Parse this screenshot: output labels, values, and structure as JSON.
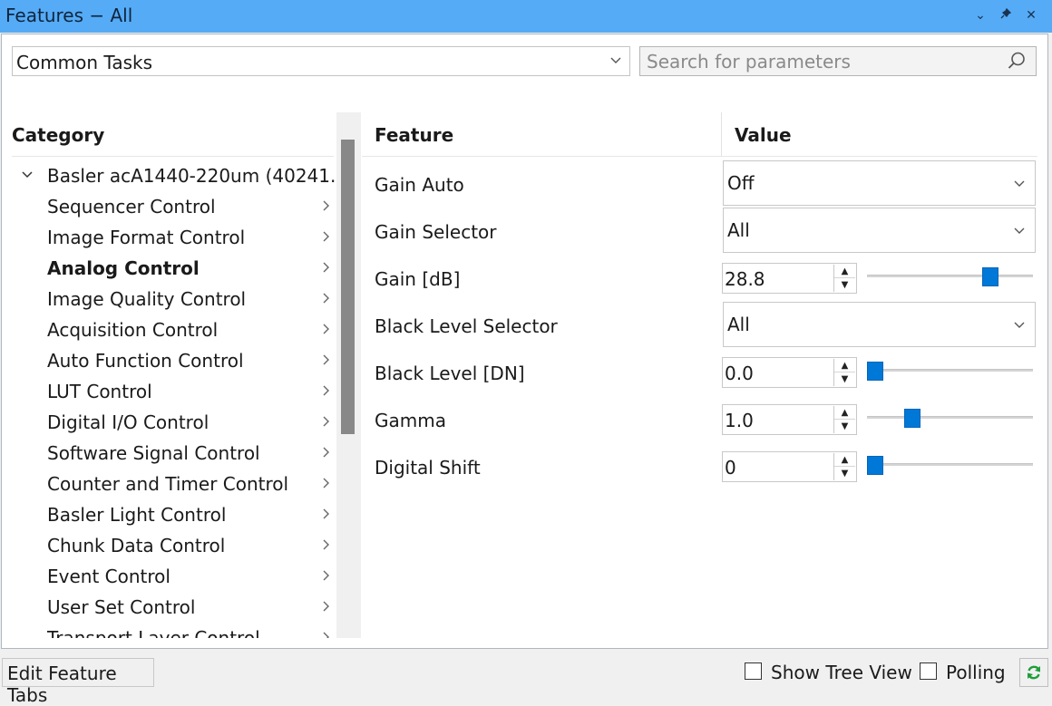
{
  "window": {
    "title": "Features − All",
    "minimize_glyph": "⌄",
    "pin_glyph": "✦",
    "close_glyph": "✕"
  },
  "toolbar": {
    "task_filter": "Common Tasks",
    "search_placeholder": "Search for parameters"
  },
  "category_pane": {
    "header": "Category",
    "root": "Basler acA1440-220um (40241...",
    "items": [
      {
        "label": "Sequencer Control",
        "selected": false
      },
      {
        "label": "Image Format Control",
        "selected": false
      },
      {
        "label": "Analog Control",
        "selected": true
      },
      {
        "label": "Image Quality Control",
        "selected": false
      },
      {
        "label": "Acquisition Control",
        "selected": false
      },
      {
        "label": "Auto Function Control",
        "selected": false
      },
      {
        "label": "LUT Control",
        "selected": false
      },
      {
        "label": "Digital I/O Control",
        "selected": false
      },
      {
        "label": "Software Signal Control",
        "selected": false
      },
      {
        "label": "Counter and Timer Control",
        "selected": false
      },
      {
        "label": "Basler Light Control",
        "selected": false
      },
      {
        "label": "Chunk Data Control",
        "selected": false
      },
      {
        "label": "Event Control",
        "selected": false
      },
      {
        "label": "User Set Control",
        "selected": false
      },
      {
        "label": "Transport Layer Control",
        "selected": false
      }
    ]
  },
  "features": {
    "feature_header": "Feature",
    "value_header": "Value",
    "rows": [
      {
        "label": "Gain Auto",
        "type": "dropdown",
        "value": "Off"
      },
      {
        "label": "Gain Selector",
        "type": "dropdown",
        "value": "All"
      },
      {
        "label": "Gain [dB]",
        "type": "spin_slider",
        "value": "28.8",
        "slider_fraction": 0.77
      },
      {
        "label": "Black Level Selector",
        "type": "dropdown",
        "value": "All"
      },
      {
        "label": "Black Level [DN]",
        "type": "spin_slider",
        "value": "0.0",
        "slider_fraction": 0.0
      },
      {
        "label": "Gamma",
        "type": "spin_slider",
        "value": "1.0",
        "slider_fraction": 0.25
      },
      {
        "label": "Digital Shift",
        "type": "spin_slider",
        "value": "0",
        "slider_fraction": 0.0
      }
    ]
  },
  "bottom_bar": {
    "edit_tabs": "Edit Feature Tabs",
    "show_tree_view": "Show Tree View",
    "show_tree_view_checked": false,
    "polling": "Polling",
    "polling_checked": false
  },
  "colors": {
    "title_bar": "#55abf6",
    "slider_handle": "#0078d7",
    "refresh_icon": "#1e9e3a"
  }
}
